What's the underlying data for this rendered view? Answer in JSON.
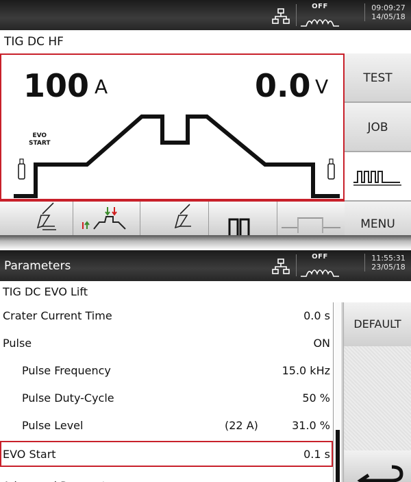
{
  "top": {
    "status": {
      "off_label": "OFF",
      "time": "09:09:27",
      "date": "14/05/18"
    },
    "mode": "TIG  DC  HF",
    "current_value": "100",
    "current_unit": "A",
    "voltage_value": "0.0",
    "voltage_unit": "V",
    "evo_label_1": "EVO",
    "evo_label_2": "START",
    "side_buttons": {
      "test": "TEST",
      "job": "JOB",
      "menu": "MENU"
    }
  },
  "bottom": {
    "title": "Parameters",
    "status": {
      "off_label": "OFF",
      "time": "11:55:31",
      "date": "23/05/18"
    },
    "mode": "TIG  DC  EVO Lift",
    "rows": [
      {
        "label": "Crater Current Time",
        "value": "0.0 s",
        "extra": ""
      },
      {
        "label": "Pulse",
        "value": "ON",
        "extra": ""
      },
      {
        "label": "Pulse Frequency",
        "value": "15.0 kHz",
        "extra": ""
      },
      {
        "label": "Pulse Duty-Cycle",
        "value": "50 %",
        "extra": ""
      },
      {
        "label": "Pulse Level",
        "value": "31.0 %",
        "extra": "(22 A)"
      },
      {
        "label": "EVO Start",
        "value": "0.1 s",
        "extra": ""
      },
      {
        "label": "Advanced Parameters",
        "value": "",
        "extra": ""
      }
    ],
    "default_button": "DEFAULT"
  },
  "colors": {
    "accent_red": "#c8202a",
    "header_dark": "#262626",
    "button_gray": "#d4d4d4"
  },
  "icons": [
    "network-icon",
    "arc-off-icon",
    "gas-bottle-icon",
    "torch-icon",
    "pulse-wave-icon",
    "return-arrow-icon"
  ]
}
